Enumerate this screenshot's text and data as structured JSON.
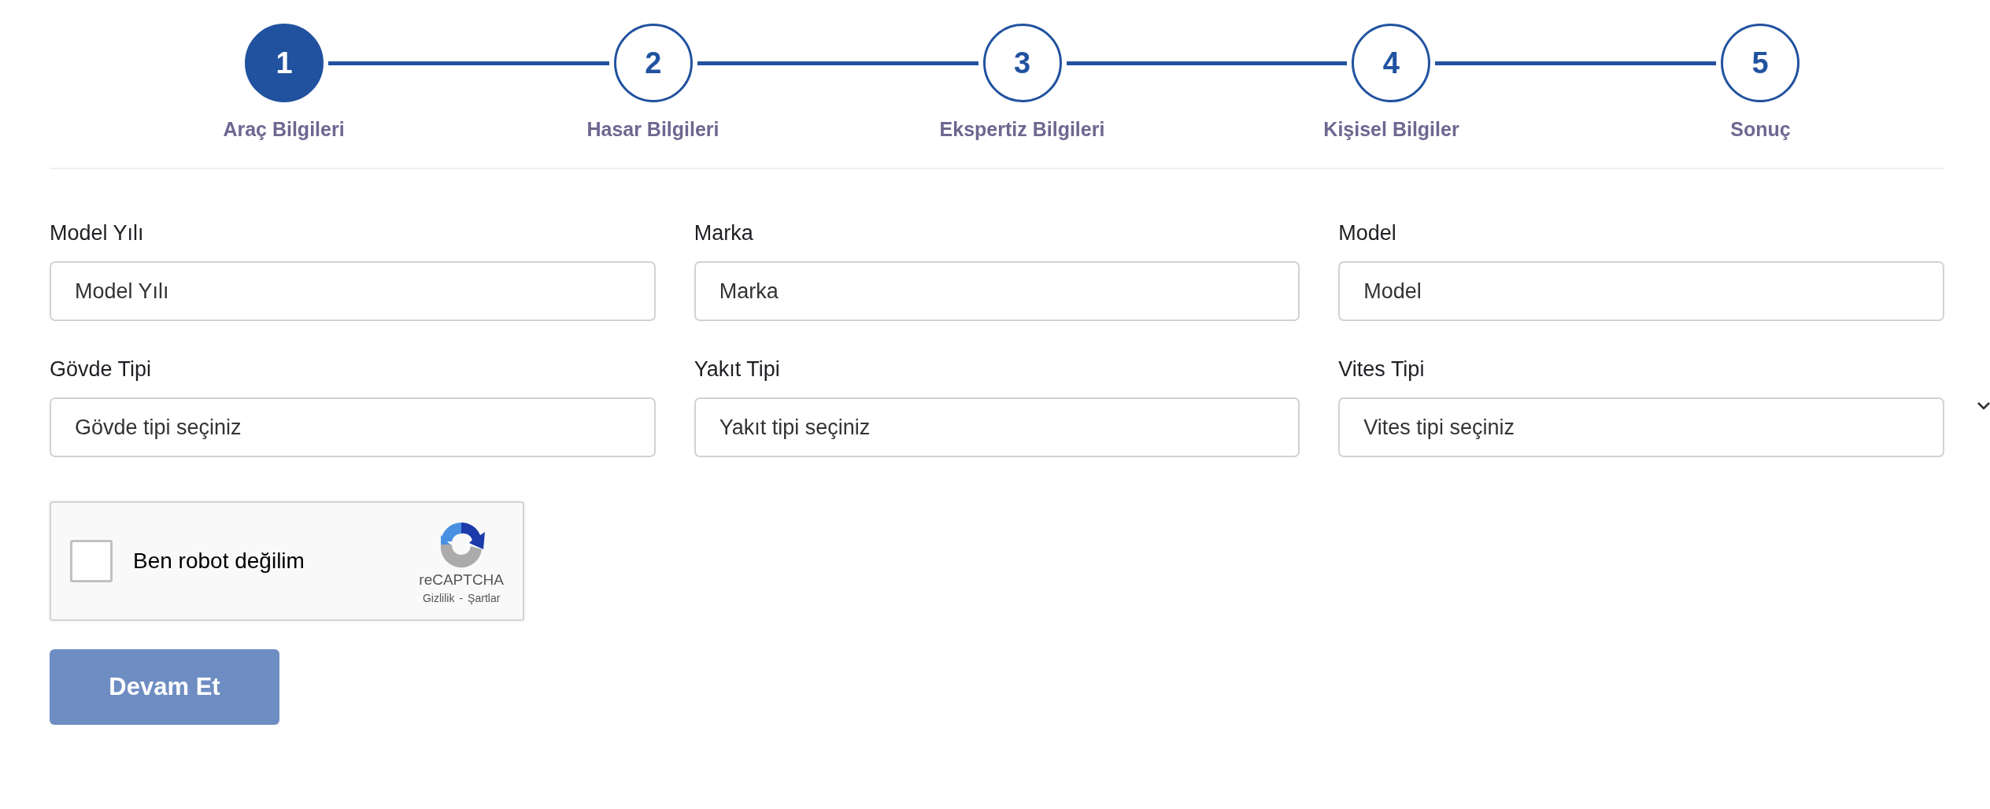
{
  "steps": [
    {
      "number": "1",
      "label": "Araç Bilgileri",
      "selected": true
    },
    {
      "number": "2",
      "label": "Hasar Bilgileri",
      "selected": false
    },
    {
      "number": "3",
      "label": "Ekspertiz Bilgileri",
      "selected": false
    },
    {
      "number": "4",
      "label": "Kişisel Bilgiler",
      "selected": false
    },
    {
      "number": "5",
      "label": "Sonuç",
      "selected": false
    }
  ],
  "fields": [
    {
      "kind": "input",
      "label": "Model Yılı",
      "placeholder": "Model Yılı"
    },
    {
      "kind": "input",
      "label": "Marka",
      "placeholder": "Marka"
    },
    {
      "kind": "input",
      "label": "Model",
      "placeholder": "Model"
    },
    {
      "kind": "select",
      "label": "Gövde Tipi",
      "value": "Gövde tipi seçiniz"
    },
    {
      "kind": "select",
      "label": "Yakıt Tipi",
      "value": "Yakıt tipi seçiniz"
    },
    {
      "kind": "select",
      "label": "Vites Tipi",
      "value": "Vites tipi seçiniz"
    }
  ],
  "captcha": {
    "label": "Ben robot değilim",
    "checked": false,
    "brand": "reCAPTCHA",
    "privacy": "Gizlilik",
    "separator": "-",
    "terms": "Şartlar"
  },
  "submit": {
    "label": "Devam Et",
    "disabled": true
  }
}
